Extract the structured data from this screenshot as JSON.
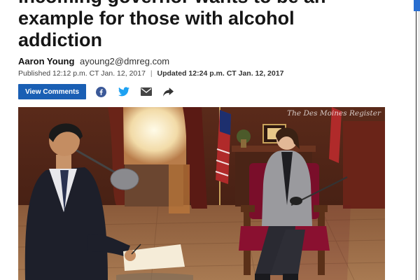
{
  "article": {
    "headline_lines": [
      "incoming governor wants to be an",
      "example for those with alcohol",
      "addiction"
    ],
    "author": "Aaron Young",
    "author_email": "ayoung2@dmreg.com",
    "published": "Published 12:12 p.m. CT Jan. 12, 2017",
    "separator": "|",
    "updated": "Updated 12:24 p.m. CT Jan. 12, 2017"
  },
  "actions": {
    "view_comments_label": "View Comments",
    "share_icons": [
      "facebook-icon",
      "twitter-icon",
      "email-icon",
      "share-arrow-icon"
    ]
  },
  "photo": {
    "watermark": "The Des Moines Register"
  },
  "colors": {
    "button_blue": "#1a5fb4",
    "facebook_blue": "#3b5998",
    "twitter_blue": "#1da1f2",
    "icon_gray": "#444444"
  }
}
